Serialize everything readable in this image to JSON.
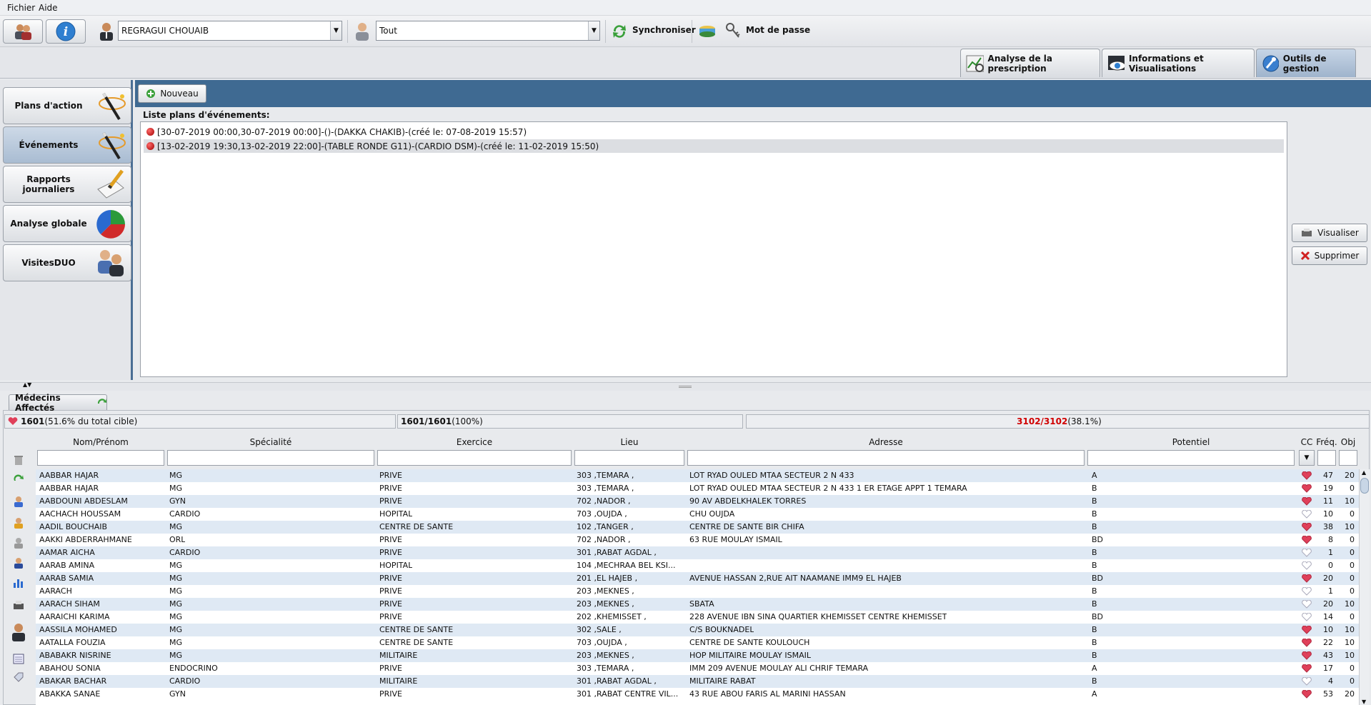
{
  "menu": [
    "Fichier",
    "Aide"
  ],
  "toolbar": {
    "user_combo": "REGRAGUI CHOUAIB",
    "filter_combo": "Tout",
    "sync_label": "Synchroniser",
    "password_label": "Mot de passe"
  },
  "top_tabs": [
    {
      "label": "Analyse de la prescription",
      "active": false
    },
    {
      "label": "Informations et Visualisations",
      "active": false
    },
    {
      "label": "Outils de gestion",
      "active": true
    }
  ],
  "left_nav": [
    {
      "label": "Plans d'action",
      "active": false,
      "icon": "wand-icon"
    },
    {
      "label": "Événements",
      "active": true,
      "icon": "wand-icon"
    },
    {
      "label": "Rapports journaliers",
      "active": false,
      "icon": "notepad-pencil-icon"
    },
    {
      "label": "Analyse globale",
      "active": false,
      "icon": "pie-chart-icon"
    },
    {
      "label": "VisitesDUO",
      "active": false,
      "icon": "two-people-icon"
    }
  ],
  "main": {
    "new_button": "Nouveau",
    "list_title": "Liste plans d'événements:",
    "events": [
      "[30-07-2019 00:00,30-07-2019 00:00]-()-(DAKKA CHAKIB)-(créé le: 07-08-2019 15:57)",
      "[13-02-2019 19:30,13-02-2019 22:00]-(TABLE RONDE G11)-(CARDIO DSM)-(créé le: 11-02-2019 15:50)"
    ],
    "visualiser_button": "Visualiser",
    "supprimer_button": "Supprimer"
  },
  "bottom": {
    "tab_label": "Médecins Affectés",
    "stat1_strong": "1601",
    "stat1_rest": " (51.6% du total cible)",
    "stat2_strong": "1601/1601",
    "stat2_rest": " (100%)",
    "stat3_strong": "3102/3102",
    "stat3_rest": " (38.1%)",
    "columns": [
      "Nom/Prénom",
      "Spécialité",
      "Exercice",
      "Lieu",
      "Adresse",
      "Potentiel",
      "CC",
      "Fréq.",
      "Obj"
    ],
    "rows": [
      {
        "nom": "AABBAR HAJAR",
        "spec": "MG",
        "exercice": "PRIVE",
        "lieu": "303 ,TEMARA ,",
        "adresse": "LOT RYAD OULED MTAA SECTEUR 2 N 433",
        "potentiel": "A",
        "cc": "full",
        "freq": "47",
        "obj": "20"
      },
      {
        "nom": "AABBAR HAJAR",
        "spec": "MG",
        "exercice": "PRIVE",
        "lieu": "303 ,TEMARA ,",
        "adresse": "LOT RYAD OULED MTAA SECTEUR 2 N 433 1 ER ETAGE APPT 1 TEMARA",
        "potentiel": "B",
        "cc": "full",
        "freq": "19",
        "obj": "0"
      },
      {
        "nom": "AABDOUNI ABDESLAM",
        "spec": "GYN",
        "exercice": "PRIVE",
        "lieu": "702 ,NADOR ,",
        "adresse": "90 AV ABDELKHALEK TORRES",
        "potentiel": "B",
        "cc": "full",
        "freq": "11",
        "obj": "10"
      },
      {
        "nom": "AACHACH HOUSSAM",
        "spec": "CARDIO",
        "exercice": "HOPITAL",
        "lieu": "703 ,OUJDA ,",
        "adresse": "CHU OUJDA",
        "potentiel": "B",
        "cc": "empty",
        "freq": "10",
        "obj": "0"
      },
      {
        "nom": "AADIL BOUCHAIB",
        "spec": "MG",
        "exercice": "CENTRE DE SANTE",
        "lieu": "102 ,TANGER ,",
        "adresse": "CENTRE DE SANTE BIR CHIFA",
        "potentiel": "B",
        "cc": "full",
        "freq": "38",
        "obj": "10"
      },
      {
        "nom": "AAKKI ABDERRAHMANE",
        "spec": "ORL",
        "exercice": "PRIVE",
        "lieu": "702 ,NADOR ,",
        "adresse": "63 RUE MOULAY ISMAIL",
        "potentiel": "BD",
        "cc": "full",
        "freq": "8",
        "obj": "0"
      },
      {
        "nom": "AAMAR AICHA",
        "spec": "CARDIO",
        "exercice": "PRIVE",
        "lieu": "301 ,RABAT AGDAL ,",
        "adresse": "",
        "potentiel": "B",
        "cc": "empty",
        "freq": "1",
        "obj": "0"
      },
      {
        "nom": "AARAB AMINA",
        "spec": "MG",
        "exercice": "HOPITAL",
        "lieu": "104 ,MECHRAA BEL KSI...",
        "adresse": "",
        "potentiel": "B",
        "cc": "empty",
        "freq": "0",
        "obj": "0"
      },
      {
        "nom": "AARAB SAMIA",
        "spec": "MG",
        "exercice": "PRIVE",
        "lieu": "201 ,EL HAJEB ,",
        "adresse": "AVENUE HASSAN 2,RUE AIT NAAMANE IMM9 EL HAJEB",
        "potentiel": "BD",
        "cc": "full",
        "freq": "20",
        "obj": "0"
      },
      {
        "nom": "AARACH",
        "spec": "MG",
        "exercice": "PRIVE",
        "lieu": "203 ,MEKNES ,",
        "adresse": "",
        "potentiel": "B",
        "cc": "empty",
        "freq": "1",
        "obj": "0"
      },
      {
        "nom": "AARACH SIHAM",
        "spec": "MG",
        "exercice": "PRIVE",
        "lieu": "203 ,MEKNES ,",
        "adresse": "SBATA",
        "potentiel": "B",
        "cc": "empty",
        "freq": "20",
        "obj": "10"
      },
      {
        "nom": "AARAICHI KARIMA",
        "spec": "MG",
        "exercice": "PRIVE",
        "lieu": "202 ,KHEMISSET ,",
        "adresse": "228 AVENUE IBN SINA QUARTIER KHEMISSET CENTRE KHEMISSET",
        "potentiel": "BD",
        "cc": "empty",
        "freq": "14",
        "obj": "0"
      },
      {
        "nom": "AASSILA MOHAMED",
        "spec": "MG",
        "exercice": "CENTRE DE SANTE",
        "lieu": "302 ,SALE ,",
        "adresse": "C/S BOUKNADEL",
        "potentiel": "B",
        "cc": "full",
        "freq": "10",
        "obj": "10"
      },
      {
        "nom": "AATALLA FOUZIA",
        "spec": "MG",
        "exercice": "CENTRE DE SANTE",
        "lieu": "703 ,OUJDA ,",
        "adresse": "CENTRE DE SANTE KOULOUCH",
        "potentiel": "B",
        "cc": "full",
        "freq": "22",
        "obj": "10"
      },
      {
        "nom": "ABABAKR NISRINE",
        "spec": "MG",
        "exercice": "MILITAIRE",
        "lieu": "203 ,MEKNES ,",
        "adresse": "HOP MILITAIRE MOULAY ISMAIL",
        "potentiel": "B",
        "cc": "full",
        "freq": "43",
        "obj": "10"
      },
      {
        "nom": "ABAHOU SONIA",
        "spec": "ENDOCRINO",
        "exercice": "PRIVE",
        "lieu": "303 ,TEMARA ,",
        "adresse": "IMM 209 AVENUE MOULAY ALI CHRIF TEMARA",
        "potentiel": "A",
        "cc": "full",
        "freq": "17",
        "obj": "0"
      },
      {
        "nom": "ABAKAR BACHAR",
        "spec": "CARDIO",
        "exercice": "MILITAIRE",
        "lieu": "301 ,RABAT AGDAL ,",
        "adresse": "MILITAIRE RABAT",
        "potentiel": "B",
        "cc": "empty",
        "freq": "4",
        "obj": "0"
      },
      {
        "nom": "ABAKKA SANAE",
        "spec": "GYN",
        "exercice": "PRIVE",
        "lieu": "301 ,RABAT CENTRE VIL...",
        "adresse": "43 RUE ABOU FARIS AL MARINI HASSAN",
        "potentiel": "A",
        "cc": "full",
        "freq": "53",
        "obj": "20"
      }
    ]
  },
  "colors": {
    "accent": "#3f6a92",
    "row_alt": "#dfe9f4",
    "heart": "#e0405a",
    "stat3": "#d00000"
  }
}
